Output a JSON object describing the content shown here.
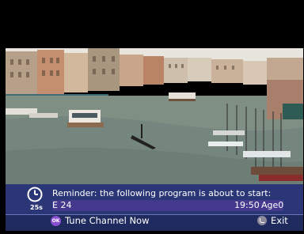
{
  "osd": {
    "timer": "25s",
    "reminder_message": "Reminder: the following program is about to start:",
    "channel": "E 24",
    "time": "19:50",
    "age": "Age0",
    "ok_key": "OK",
    "tune_label": "Tune Channel Now",
    "exit_label": "Exit"
  },
  "colors": {
    "banner_bg": "#1f2a5e",
    "banner_top": "#2a3676",
    "channel_row": "#433a8e",
    "ok_icon": "#8a4fd0"
  },
  "icons": {
    "clock": "clock-icon",
    "ok": "ok-key-icon",
    "exit": "exit-key-icon"
  }
}
